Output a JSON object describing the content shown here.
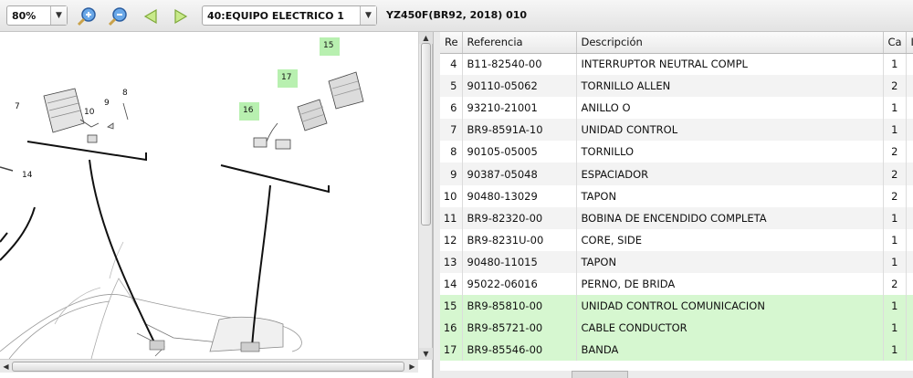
{
  "toolbar": {
    "zoom_value": "80%",
    "group_value": "40:EQUIPO ELECTRICO 1",
    "model_title": "YZ450F(BR92, 2018) 010"
  },
  "diagram": {
    "callouts": [
      "7",
      "10",
      "9",
      "8",
      "14",
      "15",
      "17",
      "16"
    ],
    "highlight_color": "#b8f0b0"
  },
  "table": {
    "headers": [
      "Re",
      "Referencia",
      "Descripción",
      "Ca",
      "I"
    ],
    "rows": [
      {
        "ref": "4",
        "code": "B11-82540-00",
        "desc": "INTERRUPTOR NEUTRAL COMPL",
        "qty": "1",
        "highlight": false
      },
      {
        "ref": "5",
        "code": "90110-05062",
        "desc": "TORNILLO ALLEN",
        "qty": "2",
        "highlight": false
      },
      {
        "ref": "6",
        "code": "93210-21001",
        "desc": "ANILLO O",
        "qty": "1",
        "highlight": false
      },
      {
        "ref": "7",
        "code": "BR9-8591A-10",
        "desc": "UNIDAD CONTROL",
        "qty": "1",
        "highlight": false
      },
      {
        "ref": "8",
        "code": "90105-05005",
        "desc": "TORNILLO",
        "qty": "2",
        "highlight": false
      },
      {
        "ref": "9",
        "code": "90387-05048",
        "desc": "ESPACIADOR",
        "qty": "2",
        "highlight": false
      },
      {
        "ref": "10",
        "code": "90480-13029",
        "desc": "TAPON",
        "qty": "2",
        "highlight": false
      },
      {
        "ref": "11",
        "code": "BR9-82320-00",
        "desc": "BOBINA DE ENCENDIDO COMPLETA",
        "qty": "1",
        "highlight": false
      },
      {
        "ref": "12",
        "code": "BR9-8231U-00",
        "desc": "CORE, SIDE",
        "qty": "1",
        "highlight": false
      },
      {
        "ref": "13",
        "code": "90480-11015",
        "desc": "TAPON",
        "qty": "1",
        "highlight": false
      },
      {
        "ref": "14",
        "code": "95022-06016",
        "desc": "PERNO, DE BRIDA",
        "qty": "2",
        "highlight": false
      },
      {
        "ref": "15",
        "code": "BR9-85810-00",
        "desc": "UNIDAD CONTROL COMUNICACION",
        "qty": "1",
        "highlight": true
      },
      {
        "ref": "16",
        "code": "BR9-85721-00",
        "desc": "CABLE  CONDUCTOR",
        "qty": "1",
        "highlight": true
      },
      {
        "ref": "17",
        "code": "BR9-85546-00",
        "desc": "BANDA",
        "qty": "1",
        "highlight": true
      }
    ]
  }
}
